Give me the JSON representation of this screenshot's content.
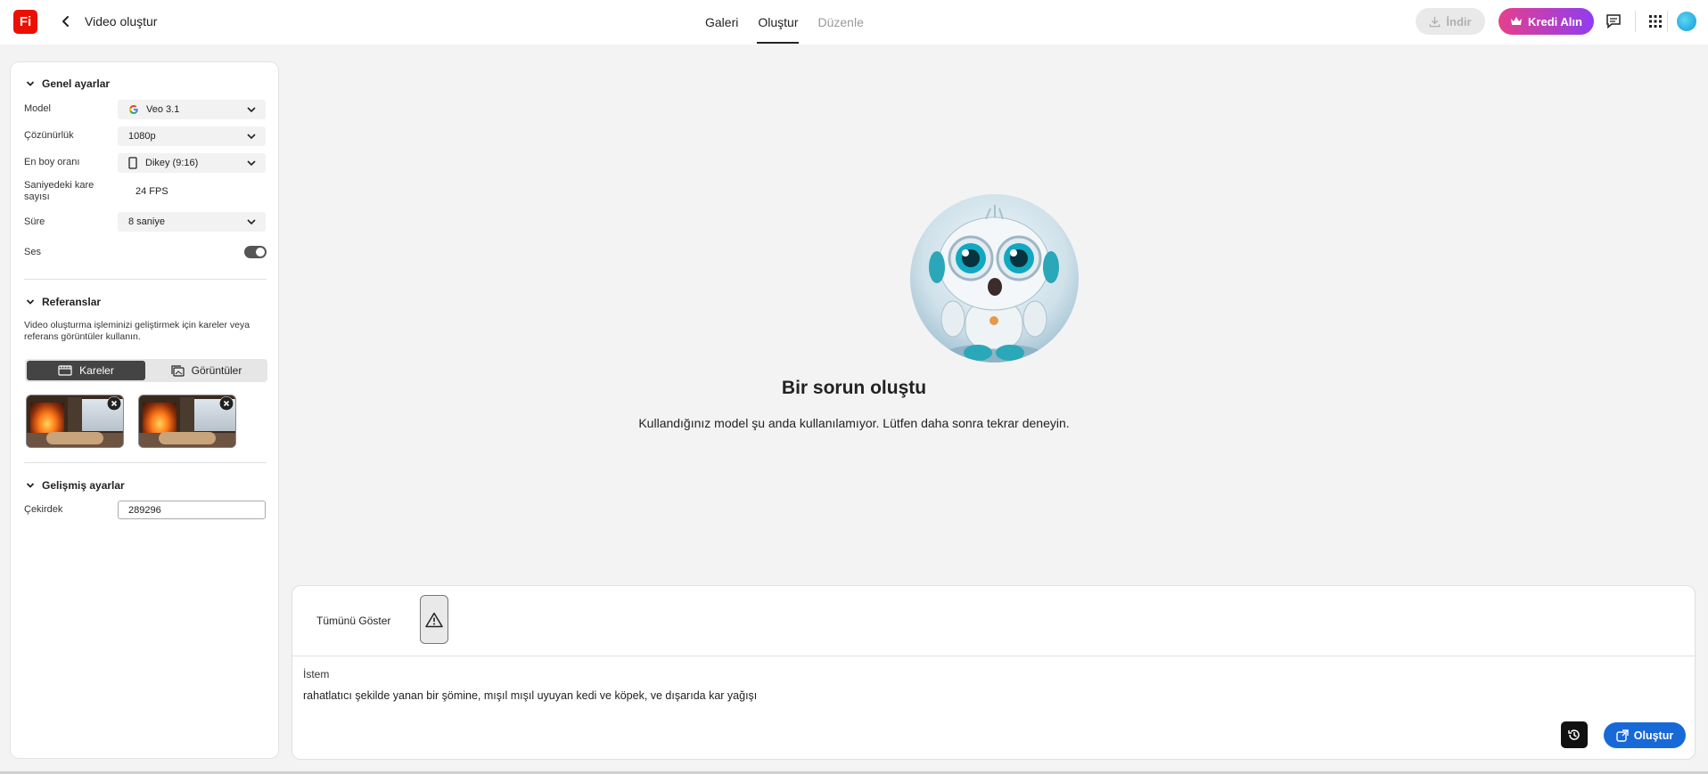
{
  "header": {
    "logo_text": "Fi",
    "title": "Video oluştur",
    "tabs": [
      {
        "label": "Galeri",
        "state": "normal"
      },
      {
        "label": "Oluştur",
        "state": "active"
      },
      {
        "label": "Düzenle",
        "state": "disabled"
      }
    ],
    "download_label": "İndir",
    "credit_label": "Kredi Alın"
  },
  "sidebar": {
    "general": {
      "title": "Genel ayarlar",
      "model_label": "Model",
      "model_value": "Veo 3.1",
      "resolution_label": "Çözünürlük",
      "resolution_value": "1080p",
      "aspect_label": "En boy oranı",
      "aspect_value": "Dikey (9:16)",
      "fps_label": "Saniyedeki kare sayısı",
      "fps_value": "24 FPS",
      "duration_label": "Süre",
      "duration_value": "8 saniye",
      "audio_label": "Ses",
      "audio_on": true
    },
    "references": {
      "title": "Referanslar",
      "description": "Video oluşturma işleminizi geliştirmek için kareler veya referans görüntüler kullanın.",
      "tab_frames": "Kareler",
      "tab_images": "Görüntüler"
    },
    "advanced": {
      "title": "Gelişmiş ayarlar",
      "seed_label": "Çekirdek",
      "seed_value": "289296"
    }
  },
  "main": {
    "error_title": "Bir sorun oluştu",
    "error_message": "Kullandığınız model şu anda kullanılamıyor. Lütfen daha sonra tekrar deneyin."
  },
  "prompt": {
    "show_all": "Tümünü Göster",
    "label": "İstem",
    "text": "rahatlatıcı şekilde yanan bir şömine, mışıl mışıl uyuyan kedi ve köpek, ve dışarıda kar yağışı",
    "create_label": "Oluştur"
  },
  "colors": {
    "brand": "#eb1000",
    "primary": "#1769d8",
    "credit_gradient_start": "#e63f8c",
    "credit_gradient_end": "#8f3df0"
  }
}
